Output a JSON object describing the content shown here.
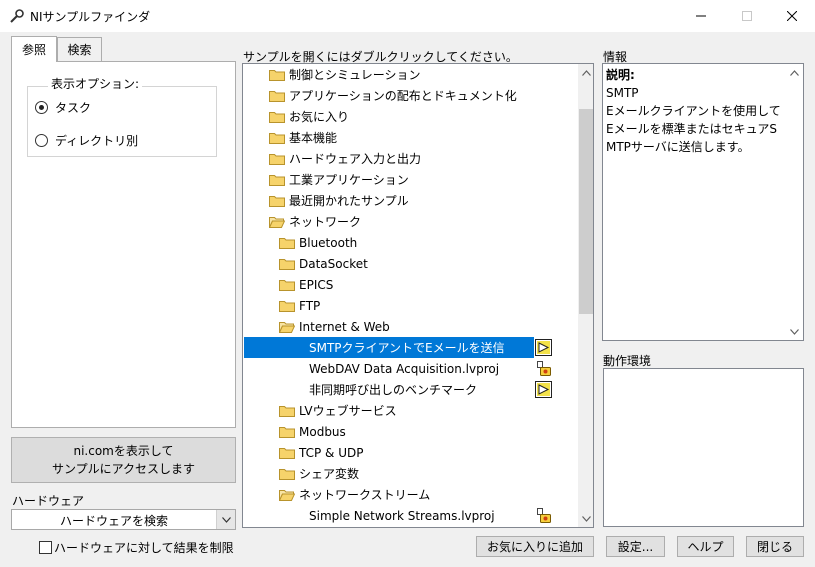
{
  "window": {
    "title": "NIサンプルファインダ",
    "app_icon": "probe-icon"
  },
  "tabs": [
    {
      "label": "参照",
      "active": true
    },
    {
      "label": "検索",
      "active": false
    }
  ],
  "display_options": {
    "label": "表示オプション:",
    "options": [
      {
        "label": "タスク",
        "selected": true
      },
      {
        "label": "ディレクトリ別",
        "selected": false
      }
    ]
  },
  "ni_button": {
    "line1": "ni.comを表示して",
    "line2": "サンプルにアクセスします"
  },
  "hardware": {
    "label": "ハードウェア",
    "select_value": "ハードウェアを検索",
    "limit_checkbox_label": "ハードウェアに対して結果を制限",
    "limit_checked": false
  },
  "list": {
    "label": "サンプルを開くにはダブルクリックしてください。",
    "rows": [
      {
        "label": "制御とシミュレーション",
        "type": "folder",
        "indent": 0
      },
      {
        "label": "アプリケーションの配布とドキュメント化",
        "type": "folder",
        "indent": 0
      },
      {
        "label": "お気に入り",
        "type": "folder",
        "indent": 0
      },
      {
        "label": "基本機能",
        "type": "folder",
        "indent": 0
      },
      {
        "label": "ハードウェア入力と出力",
        "type": "folder",
        "indent": 0
      },
      {
        "label": "工業アプリケーション",
        "type": "folder",
        "indent": 0
      },
      {
        "label": "最近開かれたサンプル",
        "type": "folder",
        "indent": 0
      },
      {
        "label": "ネットワーク",
        "type": "folder-open",
        "indent": 0
      },
      {
        "label": "Bluetooth",
        "type": "folder",
        "indent": 1
      },
      {
        "label": "DataSocket",
        "type": "folder",
        "indent": 1
      },
      {
        "label": "EPICS",
        "type": "folder",
        "indent": 1
      },
      {
        "label": "FTP",
        "type": "folder",
        "indent": 1
      },
      {
        "label": "Internet & Web",
        "type": "folder-open",
        "indent": 1
      },
      {
        "label": "SMTPクライアントでEメールを送信",
        "type": "vi",
        "indent": 2,
        "selected": true
      },
      {
        "label": "WebDAV Data Acquisition.lvproj",
        "type": "project",
        "indent": 2
      },
      {
        "label": "非同期呼び出しのベンチマーク",
        "type": "vi",
        "indent": 2
      },
      {
        "label": "LVウェブサービス",
        "type": "folder",
        "indent": 1
      },
      {
        "label": "Modbus",
        "type": "folder",
        "indent": 1
      },
      {
        "label": "TCP & UDP",
        "type": "folder",
        "indent": 1
      },
      {
        "label": "シェア変数",
        "type": "folder",
        "indent": 1
      },
      {
        "label": "ネットワークストリーム",
        "type": "folder-open",
        "indent": 1
      },
      {
        "label": "Simple Network Streams.lvproj",
        "type": "project",
        "indent": 2
      }
    ]
  },
  "info": {
    "label": "情報",
    "heading": "説明:",
    "lines": [
      "SMTP",
      "Eメールクライアントを使用して",
      "Eメールを標準またはセキュアS",
      "MTPサーバに送信します。"
    ]
  },
  "environment": {
    "label": "動作環境"
  },
  "buttons": {
    "favorite": "お気に入りに追加",
    "settings": "設定...",
    "help": "ヘルプ",
    "close": "閉じる"
  },
  "colors": {
    "selection": "#0078d7",
    "folder": "#f6d36b"
  }
}
